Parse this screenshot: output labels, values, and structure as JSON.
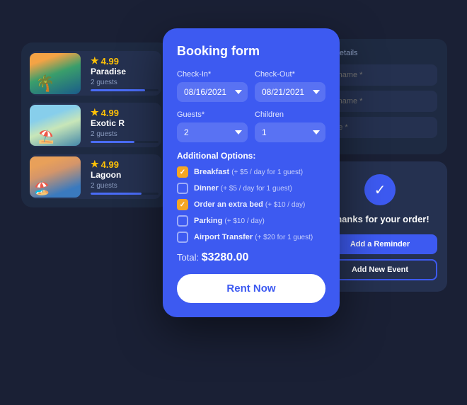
{
  "leftPanel": {
    "properties": [
      {
        "name": "Paradise",
        "guests": "2 guests",
        "rating": "4.99",
        "progressWidth": "80%"
      },
      {
        "name": "Exotic R",
        "guests": "2 guests",
        "rating": "4.99",
        "progressWidth": "65%"
      },
      {
        "name": "Lagoon",
        "guests": "2 guests",
        "rating": "4.99",
        "progressWidth": "75%"
      }
    ]
  },
  "bookingForm": {
    "title": "Booking form",
    "checkinLabel": "Check-In*",
    "checkinValue": "08/16/2021",
    "checkoutLabel": "Check-Out*",
    "checkoutValue": "08/21/2021",
    "guestsLabel": "Guests*",
    "guestsValue": "2",
    "childrenLabel": "Children",
    "childrenValue": "1",
    "additionalTitle": "Additional Options:",
    "options": [
      {
        "label": "Breakfast",
        "price": "(+ $5 / day for 1 guest)",
        "checked": true
      },
      {
        "label": "Dinner",
        "price": "(+ $5 / day for 1 guest)",
        "checked": false
      },
      {
        "label": "Order an extra bed",
        "price": "(+ $10 / day)",
        "checked": true
      },
      {
        "label": "Parking",
        "price": "(+ $10 / day)",
        "checked": false
      },
      {
        "label": "Airport Transfer",
        "price": "(+ $20 for 1 guest)",
        "checked": false
      }
    ],
    "totalLabel": "Total:",
    "totalValue": "$3280.00",
    "rentButton": "Rent Now"
  },
  "rightPanel": {
    "detailsTitle": "ing details",
    "firstNamePlaceholder": "st name *",
    "lastNamePlaceholder": "st name *",
    "phonePlaceholder": "one *",
    "thankyouCheck": "✓",
    "thankyouText": "Thanks for your order!",
    "reminderButton": "Add a Reminder",
    "newEventButton": "Add New Event"
  }
}
